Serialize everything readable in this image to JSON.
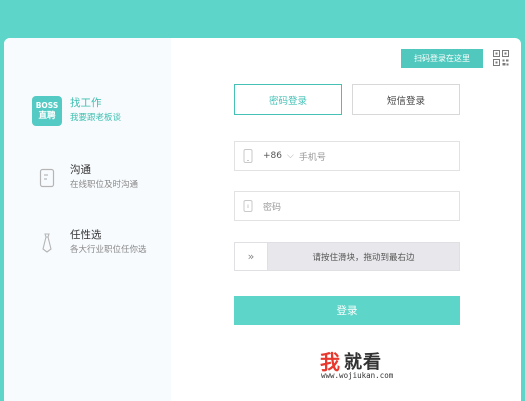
{
  "sidebar": {
    "logo": {
      "line1": "BOSS",
      "line2": "直聘"
    },
    "features": [
      {
        "title": "找工作",
        "subtitle": "我要跟老板谈",
        "icon": "boss-logo"
      },
      {
        "title": "沟通",
        "subtitle": "在线职位及时沟通",
        "icon": "chat-icon"
      },
      {
        "title": "任性选",
        "subtitle": "各大行业职位任你选",
        "icon": "tie-icon"
      }
    ]
  },
  "header": {
    "qr_banner": "扫码登录在这里",
    "qr_icon": "qr-code-icon"
  },
  "tabs": {
    "password": "密码登录",
    "sms": "短信登录"
  },
  "phone": {
    "code": "+86",
    "placeholder": "手机号"
  },
  "password": {
    "placeholder": "密码"
  },
  "slider": {
    "handle": "»",
    "text": "请按住滑块，拖动到最右边"
  },
  "login_button": "登录",
  "watermark": {
    "char1": "我",
    "rest": "就看",
    "url": "www.wojiukan.com"
  },
  "colors": {
    "accent": "#5dd5c8",
    "accent_dark": "#45c1b6",
    "brand_red": "#e8382d"
  }
}
